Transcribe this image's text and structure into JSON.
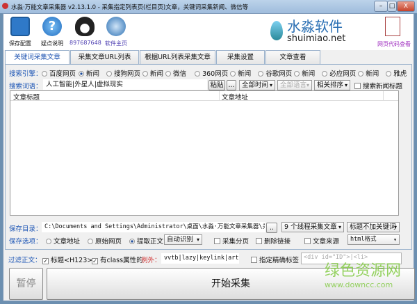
{
  "window": {
    "title": "水淼·万能文章采集器 v2.13.1.0 - 采集指定列表页(栏目页)文章，关键词采集新闻、微信等",
    "min": "–",
    "max": "□",
    "close": "X"
  },
  "toolbar": {
    "items": [
      {
        "label": "保存配置",
        "icon": "floppy-disk-icon"
      },
      {
        "label": "疑点说明",
        "icon": "help-icon"
      },
      {
        "label": "897687648",
        "icon": "qq-penguin-icon"
      },
      {
        "label": "软件主页",
        "icon": "globe-icon"
      }
    ],
    "brand": {
      "name": "水淼软件",
      "url": "shuimiao.net"
    },
    "html_view": "网页代码查看"
  },
  "tabs": [
    "关键词采集文章",
    "采集文章URL列表",
    "根据URL列表采集文章",
    "采集设置",
    "文章查看"
  ],
  "search": {
    "engine_label": "搜索引擎：",
    "engines": [
      {
        "label": "百度网页",
        "on": false
      },
      {
        "label": "新闻",
        "on": true
      },
      {
        "label": "搜狗网页",
        "on": false
      },
      {
        "label": "新闻",
        "on": false
      },
      {
        "label": "微信",
        "on": false
      },
      {
        "label": "360网页",
        "on": false
      },
      {
        "label": "新闻",
        "on": false
      },
      {
        "label": "谷歌网页",
        "on": false
      },
      {
        "label": "新闻",
        "on": false
      },
      {
        "label": "必应网页",
        "on": false
      },
      {
        "label": "新闻",
        "on": false
      },
      {
        "label": "雅虎",
        "on": false
      }
    ],
    "words_label": "搜索词语：",
    "words": "人工智能|外星人|虚拟现实",
    "paste": "粘贴",
    "more": "...",
    "time": "全部时间",
    "lang": "全部语言",
    "sort": "相关排序",
    "news_title": "搜索新闻标题"
  },
  "list": {
    "col1": "文章标题",
    "col2": "文章地址"
  },
  "save": {
    "dir_label": "保存目录：",
    "dir": "C:\\Documents and Settings\\Administrator\\桌面\\水淼·万能文章采集器\\关键",
    "browse": "..",
    "threads": "9 个线程采集文章",
    "title_opt": "标题不加关键词",
    "opt_label": "保存选项：",
    "opt_url": "文章地址",
    "opt_raw": "原始网页",
    "opt_body": "提取正文",
    "auto": "自动识别",
    "paging": "采集分页",
    "del_link": "删除链接",
    "source": "文章来源",
    "format": "html格式"
  },
  "filter": {
    "label": "过滤正文：",
    "title_tag": "标题<H123>",
    "class_attr": "有class属性的",
    "except_label": "例外：",
    "except_value": "vvtb|lazy|keylink|art_t",
    "precise": "指定精确标签",
    "precise_placeholder": "<div id=\"ID\">|<li>"
  },
  "actions": {
    "pause": "暂停",
    "start": "开始采集"
  },
  "watermark": {
    "name": "绿色资源网",
    "url": "www.downcc.com"
  }
}
